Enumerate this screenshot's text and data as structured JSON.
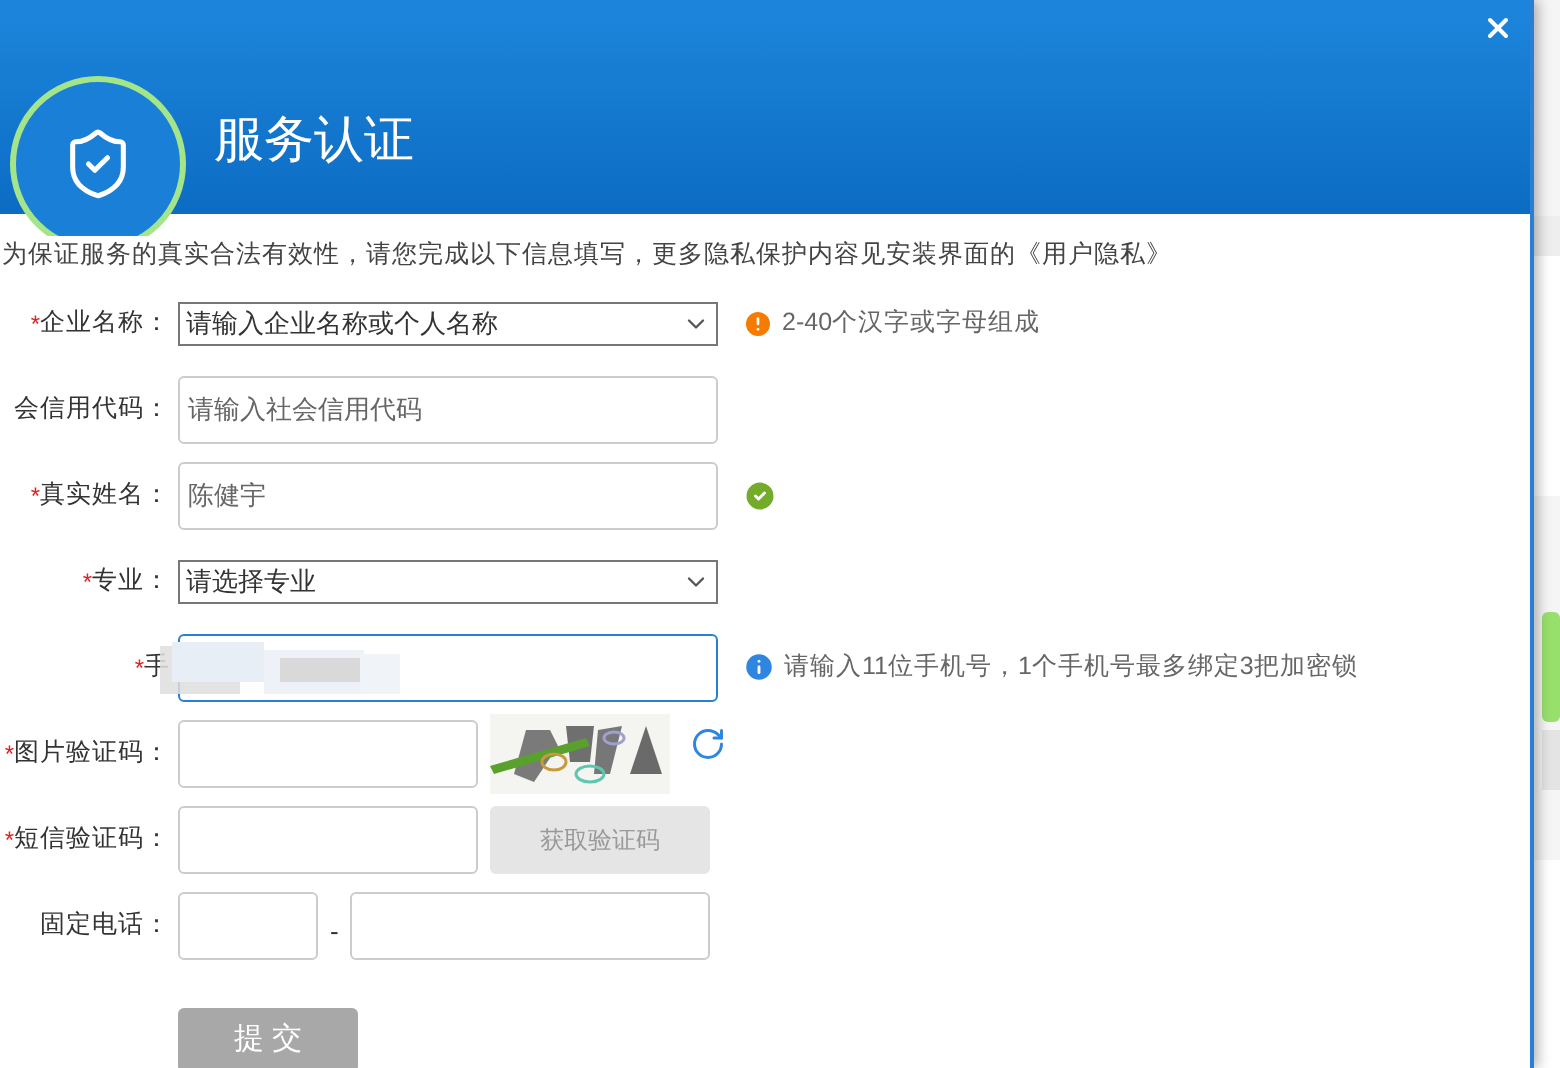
{
  "dialog": {
    "title": "服务认证",
    "intro": "为保证服务的真实合法有效性，请您完成以下信息填写，更多隐私保护内容见安装界面的《用户隐私》"
  },
  "fields": [
    {
      "kind": "select",
      "mark": "*",
      "label": "企业名称：",
      "placeholder": "请输入企业名称或个人名称",
      "hint": {
        "kind": "warning",
        "text": "2-40个汉字或字母组成"
      }
    },
    {
      "kind": "input",
      "label": "会信用代码：",
      "placeholder": "请输入社会信用代码"
    },
    {
      "kind": "input",
      "mark": "*",
      "label": "真实姓名：",
      "value": "陈健宇",
      "hint": {
        "kind": "ok"
      }
    },
    {
      "kind": "select",
      "mark": "*",
      "label": "专业：",
      "placeholder": "请选择专业"
    },
    {
      "kind": "phone",
      "mark": "*",
      "label": "手",
      "focused": true,
      "hint": {
        "kind": "info",
        "text": "请输入11位手机号，1个手机号最多绑定3把加密锁"
      }
    },
    {
      "kind": "captcha",
      "mark": "*",
      "label": "图片验证码："
    },
    {
      "kind": "sms",
      "mark": "*",
      "label": "短信验证码：",
      "button": "获取验证码",
      "button_disabled": true
    },
    {
      "kind": "landline",
      "label": "固定电话：",
      "separator": "-"
    }
  ],
  "submit": {
    "label": "提 交",
    "disabled": true
  }
}
